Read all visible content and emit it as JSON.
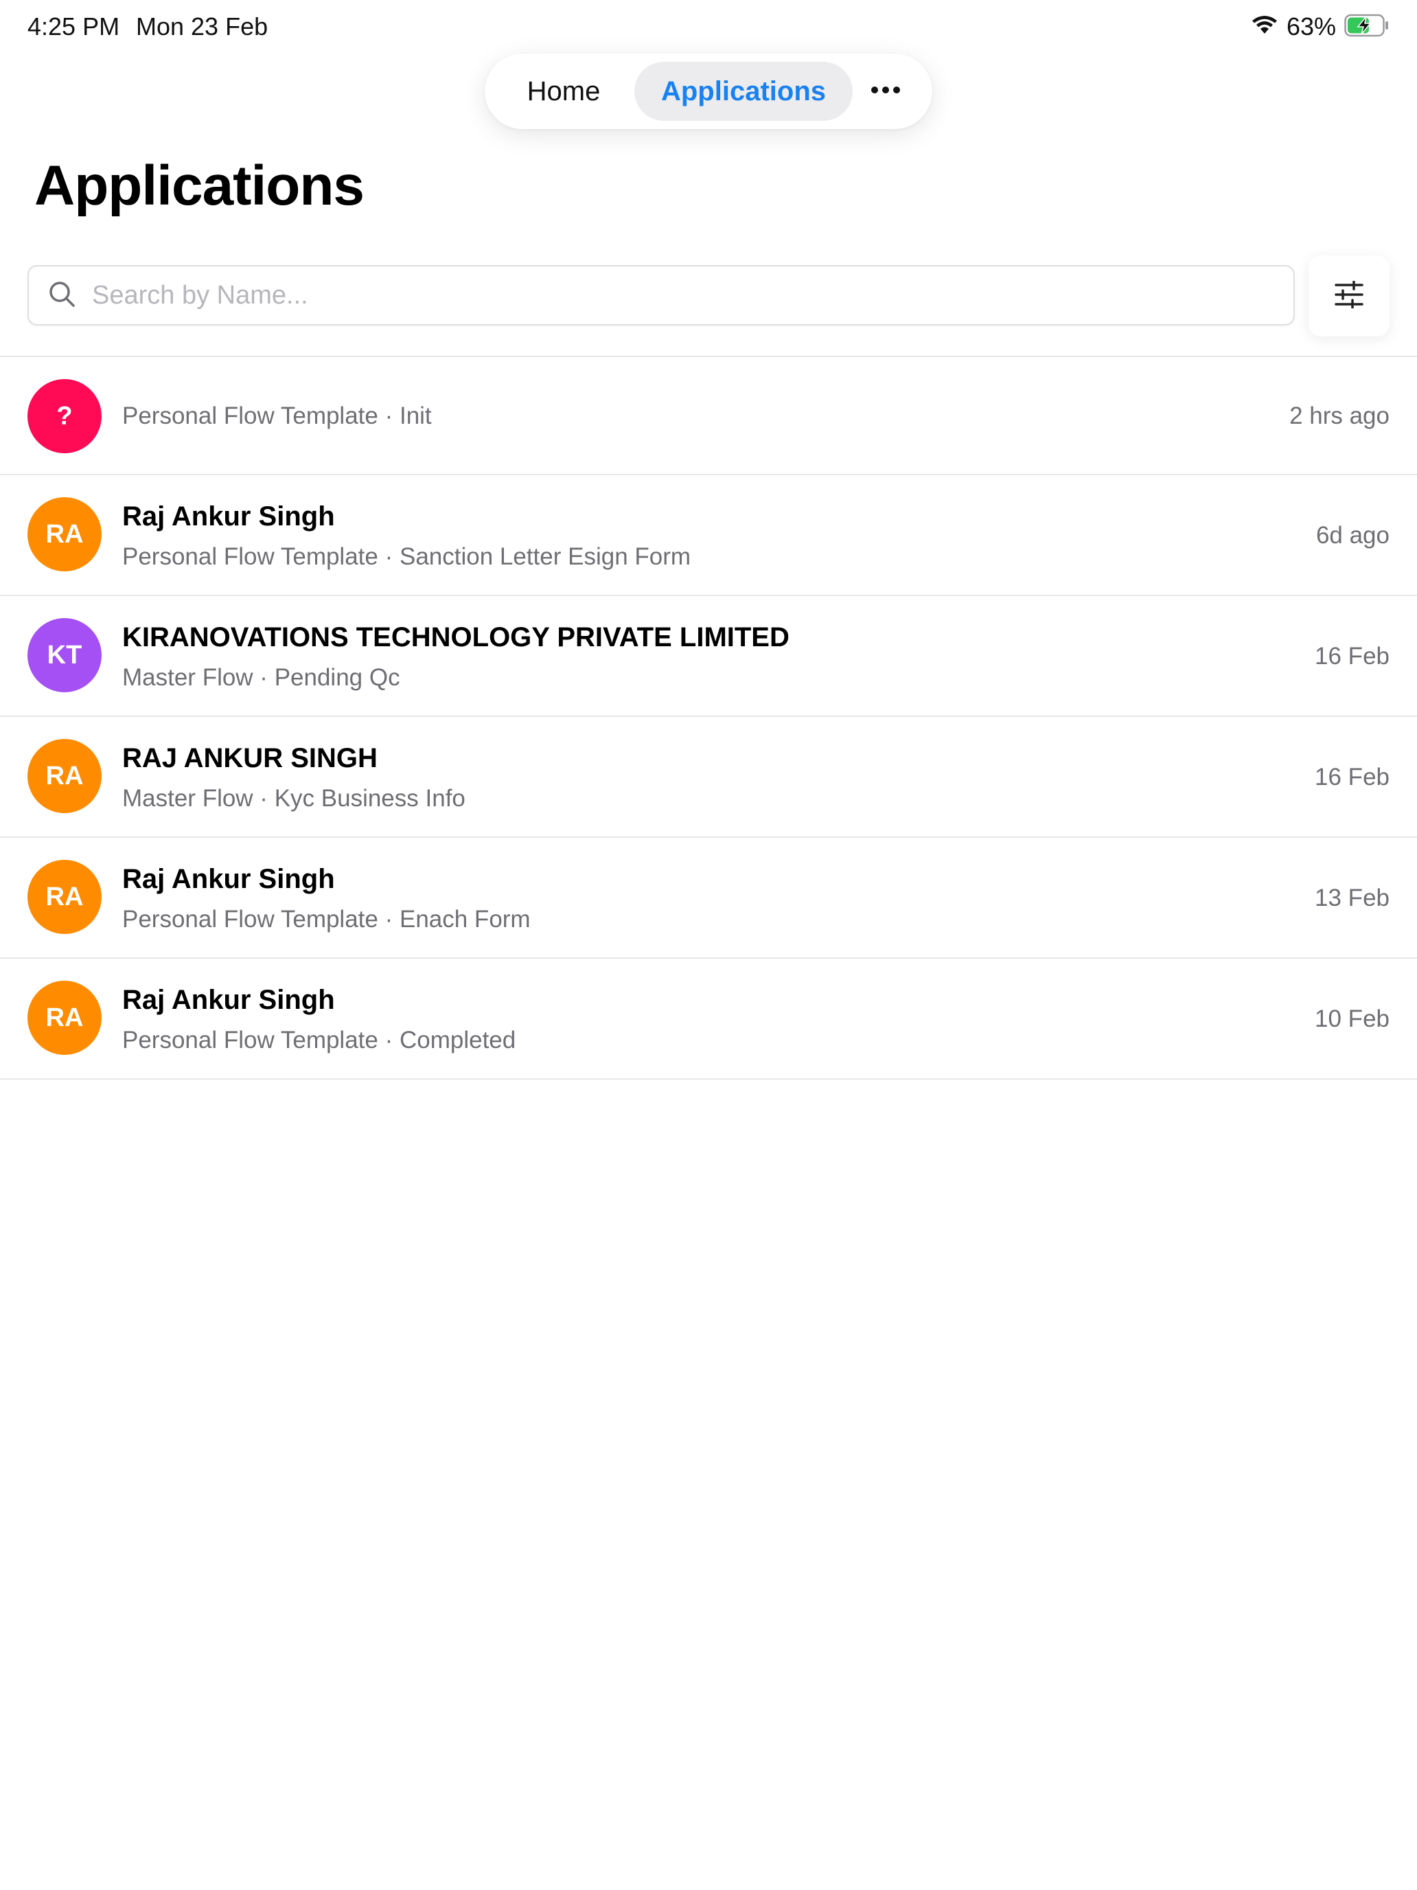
{
  "status_bar": {
    "time": "4:25 PM",
    "date": "Mon 23 Feb",
    "battery_percent": "63%",
    "battery_level": 0.63,
    "battery_color": "#34c759",
    "wifi_icon": "wifi-icon",
    "battery_icon": "battery-charging-icon"
  },
  "nav": {
    "tabs": [
      {
        "label": "Home",
        "active": false
      },
      {
        "label": "Applications",
        "active": true
      }
    ],
    "more_icon": "ellipsis-icon",
    "active_color": "#1a82f0"
  },
  "page_title": "Applications",
  "search": {
    "placeholder": "Search by Name...",
    "value": "",
    "icon": "search-icon"
  },
  "filter_icon": "sliders-icon",
  "applications": [
    {
      "initials": "?",
      "avatar_color": "#ff0a55",
      "name": "",
      "subtitle": "Personal Flow Template · Init",
      "time": "2 hrs ago"
    },
    {
      "initials": "RA",
      "avatar_color": "#ff8c00",
      "name": "Raj Ankur Singh",
      "subtitle": "Personal Flow Template · Sanction Letter Esign Form",
      "time": "6d ago"
    },
    {
      "initials": "KT",
      "avatar_color": "#a450f5",
      "name": "KIRANOVATIONS TECHNOLOGY PRIVATE LIMITED",
      "subtitle": "Master Flow · Pending Qc",
      "time": "16 Feb"
    },
    {
      "initials": "RA",
      "avatar_color": "#ff8c00",
      "name": "RAJ ANKUR SINGH",
      "subtitle": "Master Flow · Kyc Business Info",
      "time": "16 Feb"
    },
    {
      "initials": "RA",
      "avatar_color": "#ff8c00",
      "name": "Raj Ankur Singh",
      "subtitle": "Personal Flow Template · Enach Form",
      "time": "13 Feb"
    },
    {
      "initials": "RA",
      "avatar_color": "#ff8c00",
      "name": "Raj Ankur Singh",
      "subtitle": "Personal Flow Template · Completed",
      "time": "10 Feb"
    }
  ]
}
